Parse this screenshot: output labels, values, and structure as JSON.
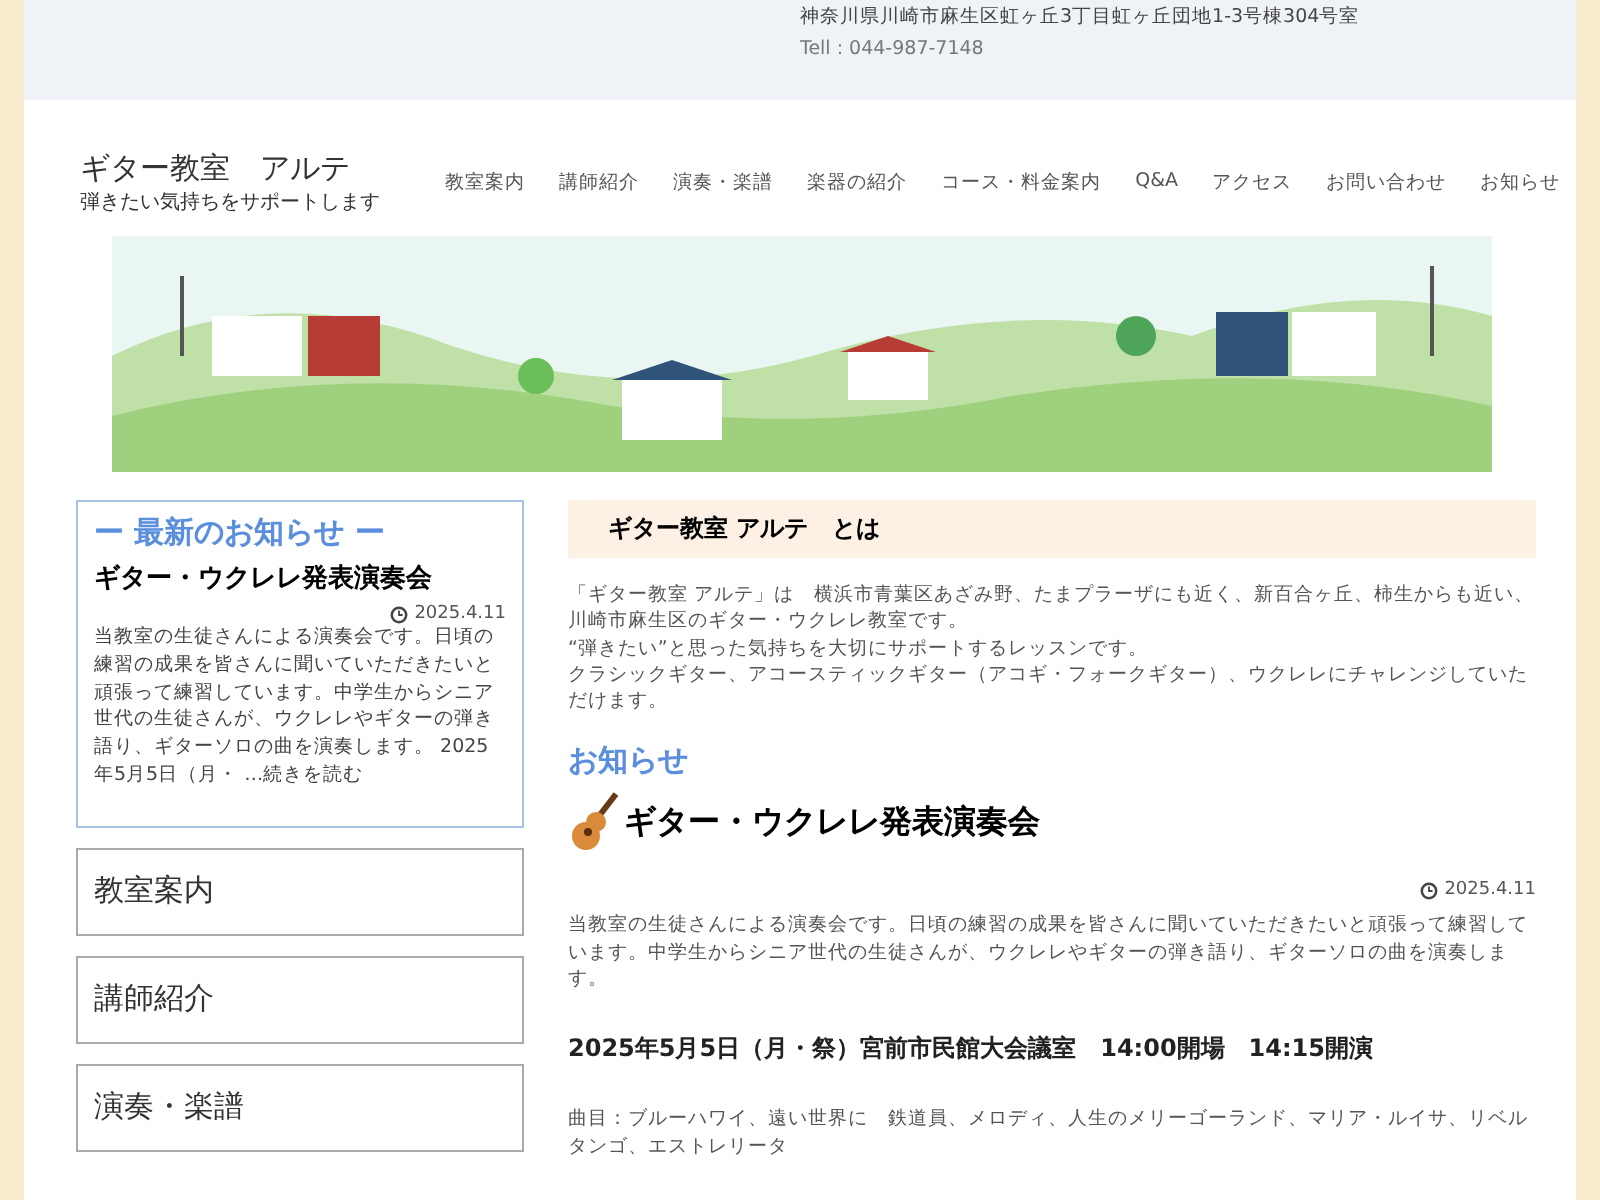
{
  "header": {
    "address": "神奈川県川崎市麻生区虹ヶ丘3丁目虹ヶ丘団地1-3号棟304号室",
    "tel": "Tell : 044-987-7148"
  },
  "site": {
    "title": "ギター教室　アルテ",
    "tagline": "弾きたい気持ちをサポートします"
  },
  "nav": [
    "教室案内",
    "講師紹介",
    "演奏・楽譜",
    "楽器の紹介",
    "コース・料金案内",
    "Q&A",
    "アクセス",
    "お問い合わせ",
    "お知らせ"
  ],
  "sidebar": {
    "news_box": {
      "heading": "ー 最新のお知らせ ー",
      "title": "ギター・ウクレレ発表演奏会",
      "date": "2025.4.11",
      "excerpt": "当教室の生徒さんによる演奏会です。日頃の練習の成果を皆さんに聞いていただきたいと頑張って練習しています。中学生からシニア世代の生徒さんが、ウクレレやギターの弾き語り、ギターソロの曲を演奏します。 2025年5月5日（月・ …",
      "more": "続きを読む"
    },
    "menu": [
      "教室案内",
      "講師紹介",
      "演奏・楽譜"
    ]
  },
  "about": {
    "heading": "ギター教室 アルテ　とは",
    "paragraphs": [
      "「ギター教室 アルテ」は　横浜市青葉区あざみ野、たまプラーザにも近く、新百合ヶ丘、柿生からも近い、川崎市麻生区のギター・ウクレレ教室です。",
      "“弾きたい”と思った気持ちを大切にサポートするレッスンです。",
      "クラシックギター、アコースティックギター（アコギ・フォークギター）、ウクレレにチャレンジしていただけます。"
    ]
  },
  "news": {
    "heading": "お知らせ",
    "post_title": "ギター・ウクレレ発表演奏会",
    "date": "2025.4.11",
    "body": "当教室の生徒さんによる演奏会です。日頃の練習の成果を皆さんに聞いていただきたいと頑張って練習しています。中学生からシニア世代の生徒さんが、ウクレレやギターの弾き語り、ギターソロの曲を演奏します。",
    "event": "2025年5月5日（月・祭）宮前市民館大会議室　14:00開場　14:15開演",
    "program": "曲目：ブルーハワイ、遠い世界に　鉄道員、メロディ、人生のメリーゴーランド、マリア・ルイサ、リベルタンゴ、エストレリータ"
  }
}
